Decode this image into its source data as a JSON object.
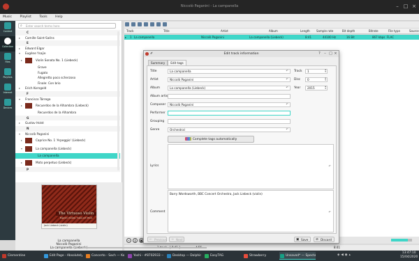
{
  "window": {
    "title": "Niccolò Paganini - La campanella"
  },
  "menu": [
    "Music",
    "Playlist",
    "Tools",
    "Help"
  ],
  "dock": [
    {
      "label": "Context",
      "active": false
    },
    {
      "label": "Collection",
      "active": true
    },
    {
      "label": "Files",
      "active": false
    },
    {
      "label": "Playlists",
      "active": false
    },
    {
      "label": "Internet",
      "active": false
    },
    {
      "label": "Devices",
      "active": false
    }
  ],
  "library": {
    "search_placeholder": "Enter search terms here",
    "items": [
      {
        "kind": "div",
        "text": "C"
      },
      {
        "kind": "artist",
        "text": "Camille Saint-Saëns"
      },
      {
        "kind": "div",
        "text": "E"
      },
      {
        "kind": "artist",
        "text": "Edward Elgar"
      },
      {
        "kind": "artist",
        "text": "Eugène Ysaÿe",
        "expanded": true
      },
      {
        "kind": "album",
        "text": "Violin Sonata No. 1 (Liebeck)"
      },
      {
        "kind": "track",
        "text": "Grave"
      },
      {
        "kind": "track",
        "text": "Fugato"
      },
      {
        "kind": "track",
        "text": "Allegretto poco scherzoso"
      },
      {
        "kind": "track",
        "text": "Finale: Con brio"
      },
      {
        "kind": "artist",
        "text": "Erich Korngold"
      },
      {
        "kind": "div",
        "text": "F"
      },
      {
        "kind": "artist",
        "text": "Francisco Tárrega",
        "expanded": true
      },
      {
        "kind": "album",
        "text": "Recuerdos de la Alhambra (Liebeck)"
      },
      {
        "kind": "track",
        "text": "Recuerdos de la Alhambra"
      },
      {
        "kind": "div",
        "text": "G"
      },
      {
        "kind": "artist",
        "text": "Gustav Holst"
      },
      {
        "kind": "div",
        "text": "N"
      },
      {
        "kind": "artist",
        "text": "Niccolò Paganini",
        "expanded": true
      },
      {
        "kind": "album",
        "text": "Caprice No. 1 'Arpeggio' (Liebeck)"
      },
      {
        "kind": "album",
        "text": "La campanella (Liebeck)",
        "expanded": true
      },
      {
        "kind": "track",
        "text": "La campanella",
        "selected": true
      },
      {
        "kind": "album",
        "text": "Moto perpetuo (Liebeck)"
      },
      {
        "kind": "div",
        "text": "P"
      }
    ]
  },
  "album_art": {
    "title": "The Virtuoso Violin",
    "subtitle": "Paganini, Kreisler, Ysaÿe and others",
    "caption": "Jack Liebeck (violin)"
  },
  "now_playing": {
    "title": "La campanella",
    "artist": "Niccolò Paganini",
    "album": "La campanella (Liebeck)"
  },
  "playlist": {
    "columns": [
      "Track",
      "Title",
      "Artist",
      "Album",
      "Length",
      "Sample rate",
      "Bit depth",
      "Bitrate",
      "File type",
      "Source"
    ],
    "row": {
      "track": "1",
      "title": "La campanella",
      "artist": "Niccolò Paganini",
      "album": "La campanella (Liebeck)",
      "length": "8:41",
      "sample_rate": "44100 Hz",
      "bit_depth": "16 Bit",
      "bitrate": "867 kbps",
      "file_type": "FLAC",
      "source": ""
    }
  },
  "status": {
    "tracks": "1 track - [ 8:41 ]",
    "elapsed": "4:55",
    "remaining": "8:41"
  },
  "dialog": {
    "title": "Edit track information",
    "tabs": [
      "Summary",
      "Edit tags"
    ],
    "active_tab": "Edit tags",
    "fields": {
      "title": {
        "label": "Title",
        "value": "La campanella"
      },
      "artist": {
        "label": "Artist",
        "value": "Niccolò Paganini"
      },
      "album": {
        "label": "Album",
        "value": "La campanella (Liebeck)"
      },
      "album_artist": {
        "label": "Album artist",
        "value": ""
      },
      "composer": {
        "label": "Composer",
        "value": "Niccolò Paganini"
      },
      "performer": {
        "label": "Performer",
        "value": ""
      },
      "grouping": {
        "label": "Grouping",
        "value": ""
      },
      "genre": {
        "label": "Genre",
        "value": "Orchestral"
      },
      "lyrics": {
        "label": "Lyrics",
        "value": ""
      },
      "comment": {
        "label": "Comment",
        "value": "Barry Wordsworth, BBC Concert Orchestra, Jack Liebeck (violin)"
      }
    },
    "spins": {
      "track": {
        "label": "Track",
        "value": "1"
      },
      "disc": {
        "label": "Disc",
        "value": "0"
      },
      "year": {
        "label": "Year",
        "value": "2015"
      }
    },
    "complete_button": "Complete tags automatically",
    "buttons": {
      "previous": "Previous",
      "next": "Next",
      "save": "Save",
      "discard": "Discard"
    }
  },
  "taskbar": {
    "tasks": [
      {
        "label": "Clementine",
        "color": "#c0392b"
      },
      {
        "label": "Edit Page - Absolutely ...",
        "color": "#3498db"
      },
      {
        "label": "Concerto - Sach — Kon...",
        "color": "#e67e22"
      },
      {
        "label": "Yoshi - #8702933 — K...",
        "color": "#8e44ad"
      },
      {
        "label": "Desktop — Dolphin",
        "color": "#2980b9"
      },
      {
        "label": "EasyTAG",
        "color": "#27ae60"
      },
      {
        "label": "Strawberry",
        "color": "#e74c3c"
      },
      {
        "label": "Unsaved* — Spectacle",
        "color": "#16a085"
      }
    ],
    "active_task": "Unsaved* — Spectacle",
    "time": "13:47:10",
    "date": "15/04/2020"
  },
  "colors": {
    "accent": "#3fd6c8",
    "taskbar": "#2b3338",
    "dock": "#2d3a40"
  }
}
